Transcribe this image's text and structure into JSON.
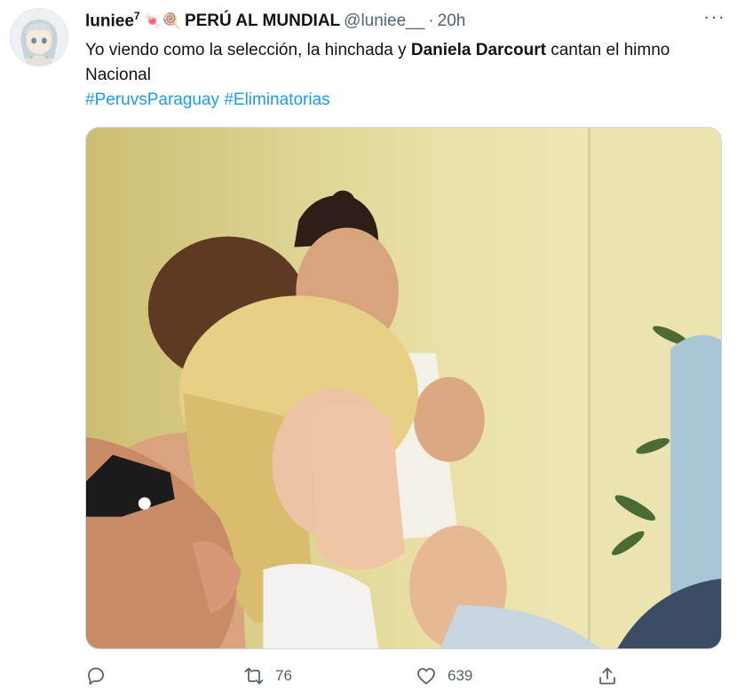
{
  "tweet": {
    "display_name": "luniee",
    "name_superscript": "7",
    "name_emojis": "🍬🍭",
    "name_suffix": "PERÚ AL MUNDIAL",
    "handle": "@luniee__",
    "separator": "·",
    "time": "20h",
    "more_label": "···",
    "text_part1": "Yo viendo como la selección, la hinchada y ",
    "text_bold": "Daniela Darcourt",
    "text_part2": " cantan el himno Nacional",
    "hashtags": [
      "#PeruvsParaguay",
      "#Eliminatorias"
    ]
  },
  "actions": {
    "reply": {
      "icon": "reply-icon",
      "count": ""
    },
    "retweet": {
      "icon": "retweet-icon",
      "count": "76"
    },
    "like": {
      "icon": "heart-icon",
      "count": "639"
    },
    "share": {
      "icon": "share-icon",
      "count": ""
    }
  },
  "colors": {
    "accent": "#1d9bf0",
    "secondary_text": "#536471",
    "primary_text": "#0f1419"
  }
}
